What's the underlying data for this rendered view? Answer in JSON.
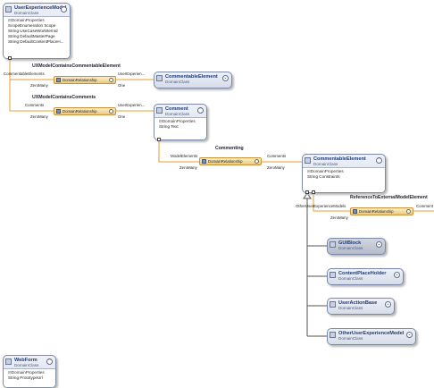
{
  "classes": {
    "user_experience_model": {
      "name": "UserExperienceModel",
      "kind": "DomainClass",
      "section": "DomainProperties",
      "properties": [
        "ScopeEnumeration Scope",
        "String UseCaseWorkItemId",
        "String DefaultMasterPage",
        "String DefaultContentPlaceH..."
      ]
    },
    "commentable_element_1": {
      "name": "CommentableElement",
      "kind": "DomainClass"
    },
    "comment": {
      "name": "Comment",
      "kind": "DomainClass",
      "section": "DomainProperties",
      "properties": [
        "String Text"
      ]
    },
    "commentable_element_2": {
      "name": "CommentableElement",
      "kind": "DomainClass",
      "section": "DomainProperties",
      "properties": [
        "String Constraints"
      ]
    },
    "gui_block": {
      "name": "GUIBlock",
      "kind": "DomainClass"
    },
    "content_place_holder": {
      "name": "ContentPlaceHolder",
      "kind": "DomainClass"
    },
    "user_action_base": {
      "name": "UserActionBase",
      "kind": "DomainClass"
    },
    "other_user_experience_model": {
      "name": "OtherUserExperienceModel",
      "kind": "DomainClass"
    },
    "web_form": {
      "name": "WebForm",
      "kind": "DomainClass",
      "section": "DomainProperties",
      "properties": [
        "String PrototypeUrl"
      ]
    }
  },
  "relationships": {
    "ux_commentable": {
      "name": "UXModelContainsCommentableElement",
      "kind": "DomainRelationship",
      "source_role": "CommentableElements",
      "source_mult": "ZeroMany",
      "target_role": "UserExperien...",
      "target_mult": "One"
    },
    "ux_comments": {
      "name": "UXModelContainsComments",
      "kind": "DomainRelationship",
      "source_role": "Comments",
      "source_mult": "ZeroMany",
      "target_role": "UserExperien...",
      "target_mult": "One"
    },
    "commenting": {
      "name": "Commenting",
      "kind": "DomainRelationship",
      "source_role": "ModelElements",
      "source_mult": "ZeroMany",
      "target_role": "Comments",
      "target_mult": "ZeroMany"
    },
    "reference_external": {
      "name": "ReferenceToExternalModelElement",
      "kind": "DomainRelationship",
      "source_role": "OtherUserExperienceModels",
      "source_mult": "ZeroMany",
      "target_role": "Comment"
    }
  }
}
